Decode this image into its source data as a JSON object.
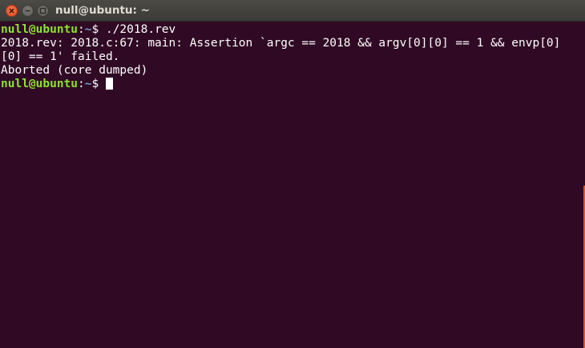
{
  "window": {
    "title": "null@ubuntu: ~"
  },
  "terminal": {
    "prompt_user": "null@ubuntu",
    "prompt_sep": ":",
    "prompt_path": "~",
    "prompt_symbol": "$ ",
    "command": "./2018.rev",
    "output_lines": [
      "2018.rev: 2018.c:67: main: Assertion `argc == 2018 && argv[0][0] == 1 && envp[0]",
      "[0] == 1' failed.",
      "Aborted (core dumped)"
    ]
  },
  "icons": {
    "close": "close-icon",
    "minimize": "minimize-icon",
    "maximize": "maximize-icon"
  },
  "colors": {
    "background": "#300a24",
    "prompt_user": "#8ae234",
    "prompt_path": "#729fcf",
    "text": "#ffffff",
    "close_button": "#e0491f",
    "scroll_indicator": "#d9541e"
  }
}
